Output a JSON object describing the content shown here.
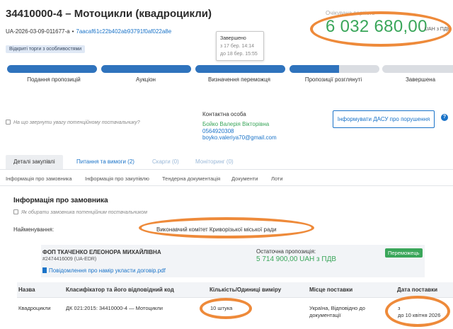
{
  "header": {
    "title": "34410000-4 – Мотоцикли (квадроцикли)",
    "tender_id": "UA-2026-03-09-011677-a",
    "separator": "•",
    "hash": "7aacaf61c22b402ab93791f0af022a8e",
    "tag": "Відкриті торги з особливостями"
  },
  "tooltip": {
    "title": "Завершено",
    "from": "з 17 бер. 14:14",
    "to": "до 18 бер. 15:55"
  },
  "value": {
    "label": "Очікувана вартість",
    "amount": "6 032 680,00",
    "currency": "UAH з ПДВ"
  },
  "stages": [
    {
      "label": "Подання пропозицій",
      "state": "done"
    },
    {
      "label": "Аукціон",
      "state": "done"
    },
    {
      "label": "Визначення переможця",
      "state": "done"
    },
    {
      "label": "Пропозиції розглянуті",
      "state": "partial"
    },
    {
      "label": "Завершена",
      "state": "todo"
    }
  ],
  "hint": "На що звернути увагу потенційному постачальнику?",
  "contact": {
    "heading": "Контактна особа",
    "name": "Бойко Валерія Вікторівна",
    "phone": "0564920308",
    "email": "boyko.valeriya70@gmail.com"
  },
  "dasu_button": "Інформувати ДАСУ про порушення",
  "help": "?",
  "tabs": [
    {
      "label": "Деталі закупівлі",
      "state": "active"
    },
    {
      "label": "Питання та вимоги (2)",
      "state": "link"
    },
    {
      "label": "Скарги (0)",
      "state": "muted"
    },
    {
      "label": "Моніторинг (0)",
      "state": "muted"
    }
  ],
  "subnav": [
    "Інформація про замовника",
    "Інформація про закупівлю",
    "Тендерна документація",
    "Документи",
    "Лоти"
  ],
  "customer": {
    "section_title": "Інформація про замовника",
    "howto": "Як обирати замовника потенційним постачальником",
    "name_label": "Найменування:",
    "name_value": "Виконавчий комітет Криворізької міської ради"
  },
  "winner": {
    "name": "ФОП ТКАЧЕНКО ЕЛЕОНОРА МИХАЙЛІВНА",
    "edr": "#2474416009 (UA-EDR)",
    "document": "Повідомлення про намір укласти договір.pdf",
    "offer_label": "Остаточна пропозиція:",
    "offer_value": "5 714 900,00 UAH з ПДВ",
    "badge": "Переможець"
  },
  "table": {
    "headers": [
      "Назва",
      "Класифікатор та його відповідний код",
      "Кількість/Одиниці виміру",
      "Місце поставки",
      "Дата поставки"
    ],
    "row": {
      "name": "Квадроцикли",
      "classifier": "ДК 021:2015: 34410000-4 — Мотоцикли",
      "quantity": "10 штука",
      "place_line1": "Україна, Відповідно до",
      "place_line2": "документації",
      "date_from": "з",
      "date_to": "до  10 квітня 2026"
    }
  },
  "colors": {
    "accent": "#1a73c8",
    "progress": "#2f73bd",
    "money": "#3aa65a",
    "highlight_ellipse": "#ee8a3a"
  }
}
